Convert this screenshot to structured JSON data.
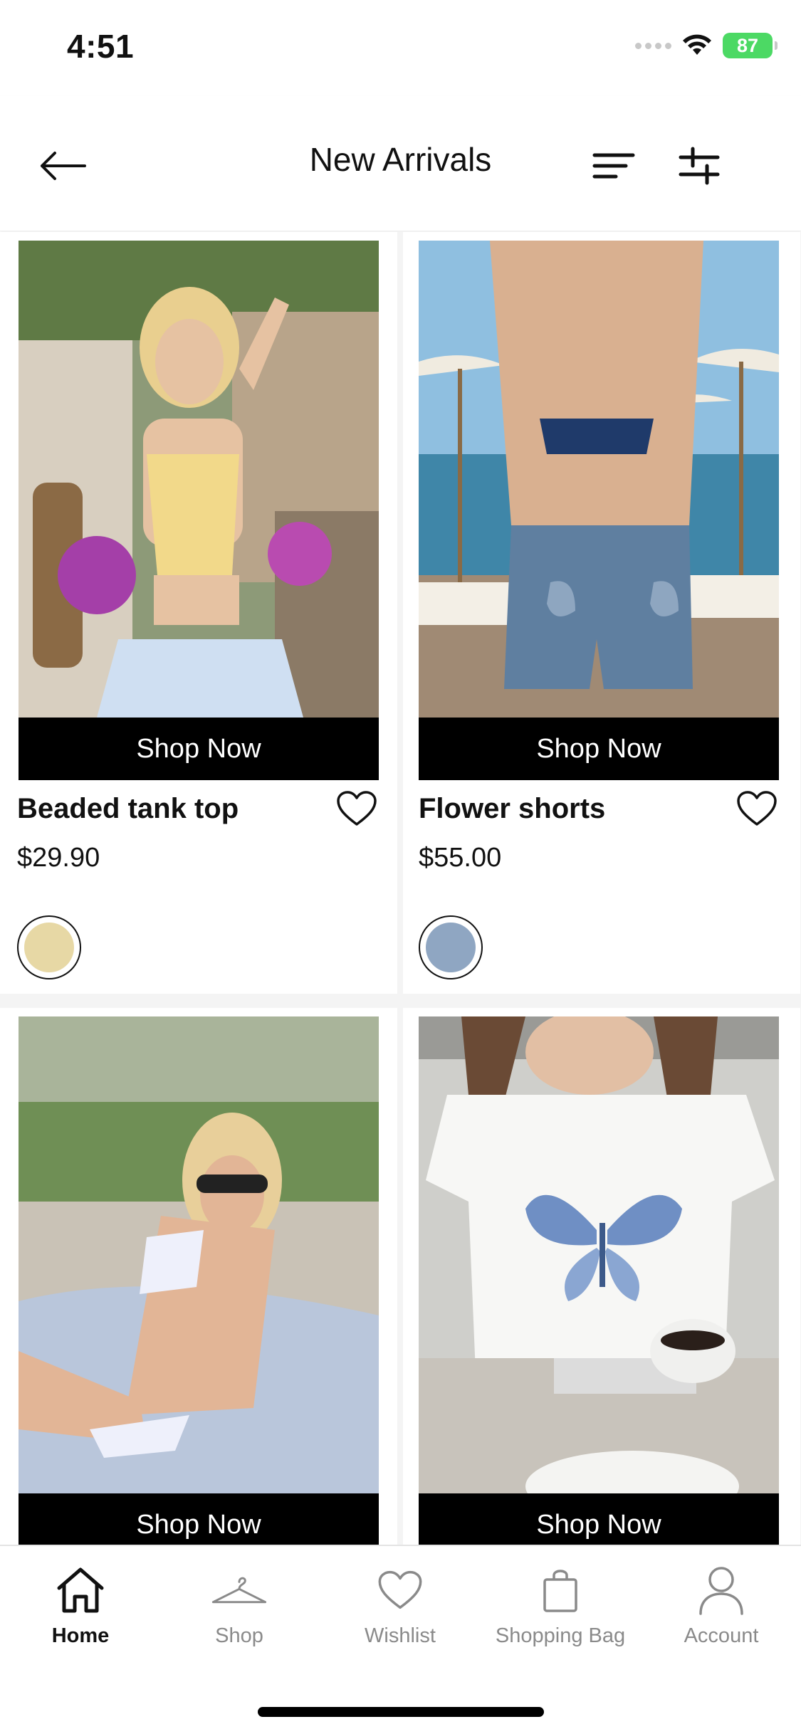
{
  "status_bar": {
    "time": "4:51",
    "battery": "87"
  },
  "header": {
    "title": "New Arrivals",
    "back_icon": "arrow-left-icon",
    "sort_icon": "sort-lines-icon",
    "filter_icon": "sliders-icon"
  },
  "products": [
    {
      "name": "Beaded tank top",
      "price": "$29.90",
      "cta": "Shop Now",
      "swatch_color": "#E7D8A5",
      "photo_colors": {
        "bg": "#9bbf7a",
        "top": "#f2d98a",
        "skin": "#e6c2a2",
        "bottom": "#cfdff2"
      }
    },
    {
      "name": "Flower shorts",
      "price": "$55.00",
      "cta": "Shop Now",
      "swatch_color": "#8FA6C2",
      "photo_colors": {
        "sky": "#8fbfe0",
        "sea": "#3f86a8",
        "skin": "#d9b090",
        "denim": "#5f7fa0"
      }
    },
    {
      "name": "",
      "price": "",
      "cta": "Shop Now",
      "photo_colors": {
        "bg": "#6f8f55",
        "rocks": "#c9c2b6",
        "towel": "#b9c6db",
        "skin": "#e2b596",
        "bikini": "#eef0fb"
      }
    },
    {
      "name": "",
      "price": "",
      "cta": "Shop Now",
      "photo_colors": {
        "bg": "#cfcfcb",
        "shirt": "#f7f7f5",
        "butterfly": "#6f8fc4",
        "hair": "#6a4a35",
        "cup": "#f0f0ee"
      }
    }
  ],
  "tabbar": {
    "items": [
      {
        "label": "Home",
        "icon": "house-icon",
        "active": true
      },
      {
        "label": "Shop",
        "icon": "hanger-icon",
        "active": false
      },
      {
        "label": "Wishlist",
        "icon": "heart-icon",
        "active": false
      },
      {
        "label": "Shopping Bag",
        "icon": "bag-icon",
        "active": false
      },
      {
        "label": "Account",
        "icon": "person-icon",
        "active": false
      }
    ]
  },
  "colors": {
    "accent": "#000000",
    "inactive_tab": "#8a8a8a",
    "battery": "#4cd964"
  }
}
